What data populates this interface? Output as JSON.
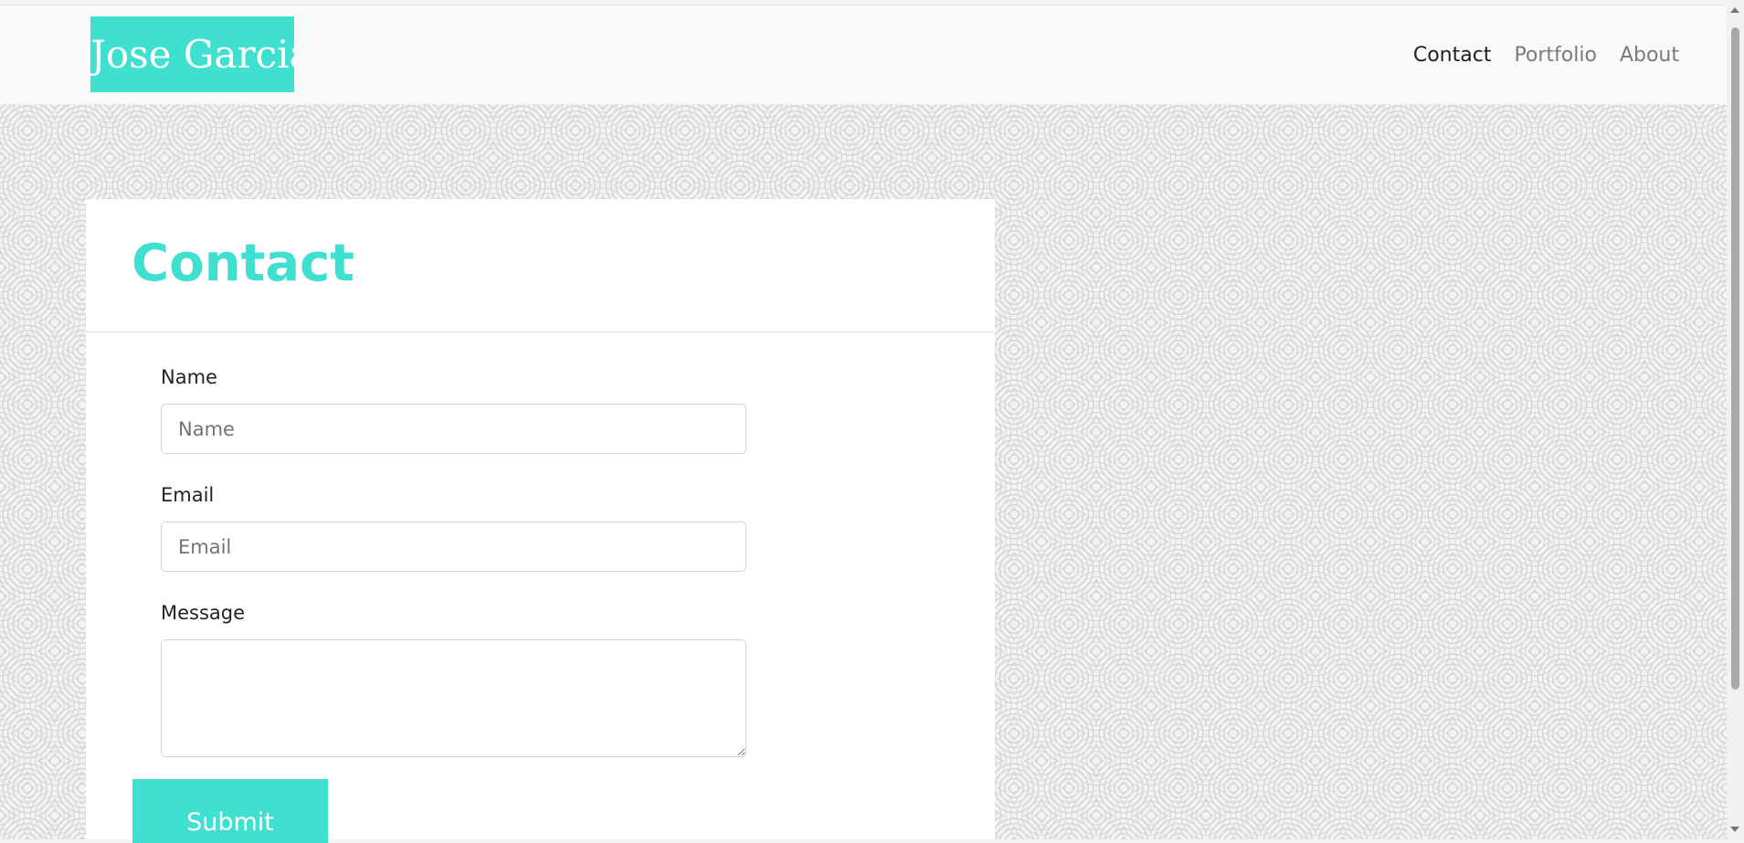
{
  "navbar": {
    "brand": "Jose Garcia",
    "links": [
      {
        "label": "Contact",
        "active": true
      },
      {
        "label": "Portfolio",
        "active": false
      },
      {
        "label": "About",
        "active": false
      }
    ]
  },
  "contact_card": {
    "title": "Contact",
    "name_label": "Name",
    "name_placeholder": "Name",
    "email_label": "Email",
    "email_placeholder": "Email",
    "message_label": "Message",
    "submit_label": "Submit"
  },
  "colors": {
    "accent": "#40e0d0",
    "navbar_bg": "#f8f9fa",
    "card_bg": "#ffffff"
  }
}
